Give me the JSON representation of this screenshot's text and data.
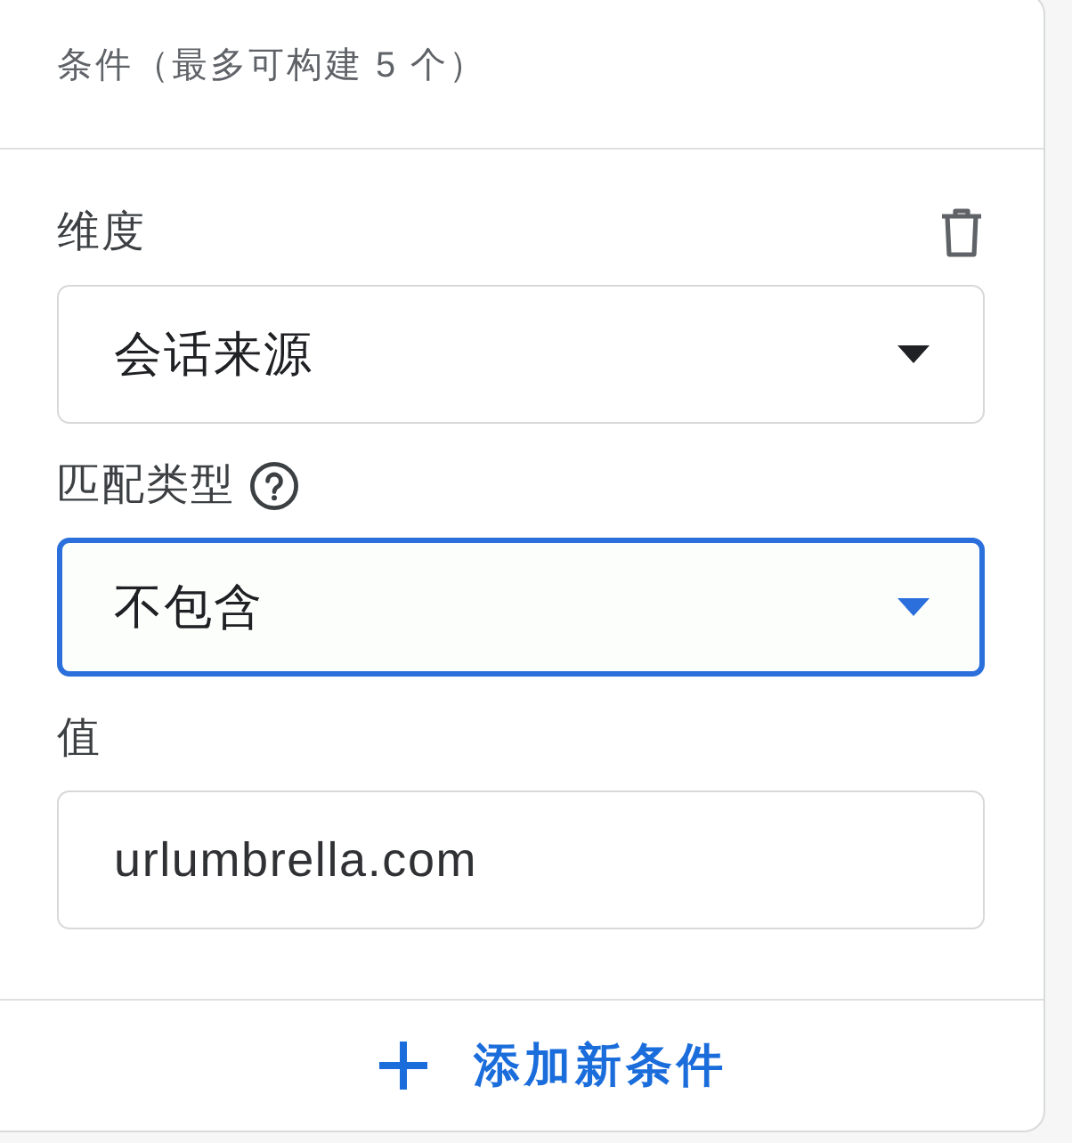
{
  "header": {
    "title": "条件（最多可构建 5 个）"
  },
  "fields": [
    {
      "kind": "select",
      "label": "维度",
      "value": "会话来源",
      "help": false,
      "focused": false
    },
    {
      "kind": "select",
      "label": "匹配类型",
      "value": "不包含",
      "help": true,
      "focused": true
    },
    {
      "kind": "text",
      "label": "值",
      "value": "urlumbrella.com",
      "help": false,
      "focused": false
    }
  ],
  "footer": {
    "add_button": "添加新条件"
  }
}
